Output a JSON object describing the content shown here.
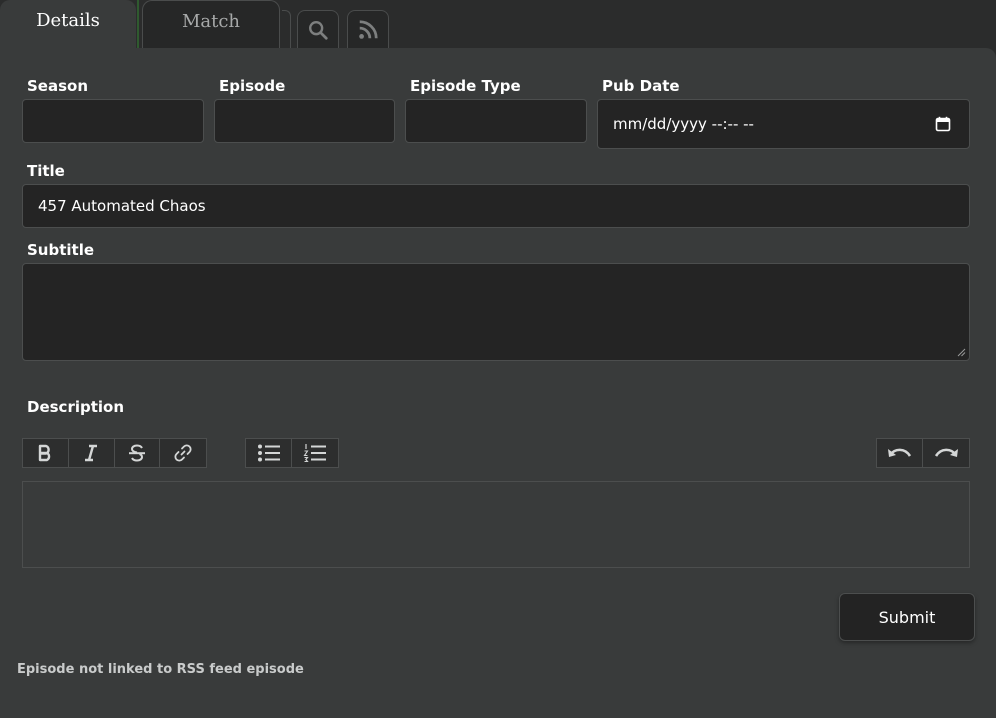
{
  "tabs": {
    "details": "Details",
    "match": "Match",
    "search_icon": "search-icon",
    "rss_icon": "rss-icon"
  },
  "form": {
    "season": {
      "label": "Season",
      "value": ""
    },
    "episode": {
      "label": "Episode",
      "value": ""
    },
    "episode_type": {
      "label": "Episode Type",
      "value": ""
    },
    "pub_date": {
      "label": "Pub Date",
      "placeholder": "mm/dd/yyyy --:-- --",
      "icon": "calendar-icon"
    },
    "title": {
      "label": "Title",
      "value": "457 Automated Chaos"
    },
    "subtitle": {
      "label": "Subtitle",
      "value": ""
    },
    "description": {
      "label": "Description",
      "toolbar": [
        "bold-icon",
        "italic-icon",
        "strikethrough-icon",
        "link-icon",
        "bullet-list-icon",
        "numbered-list-icon",
        "undo-icon",
        "redo-icon"
      ]
    },
    "submit_label": "Submit"
  },
  "status_text": "Episode not linked to RSS feed episode",
  "colors": {
    "background": "#2b2c2c",
    "panel": "#393b3b",
    "input": "#242424",
    "tab_divider": "#2f5a2f"
  }
}
